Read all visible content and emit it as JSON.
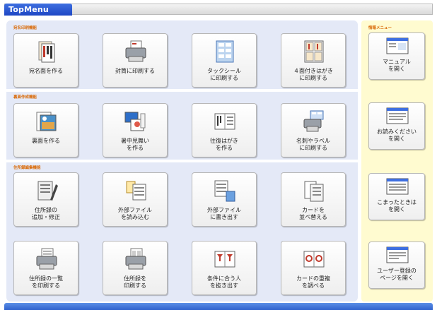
{
  "window": {
    "title": "TopMenu"
  },
  "sections": {
    "address_print": "宛名印刷機能",
    "front_create": "裏面作成機能",
    "address_book": "住所録編集機能",
    "info_menu": "情報メニュー"
  },
  "buttons": {
    "address_side": "宛名面を作る",
    "envelope": "封筒に印刷する",
    "tack_seal": "タックシール\nに印刷する",
    "four_side": "４面付きはがき\nに印刷する",
    "back_side": "裏面を作る",
    "summer_greeting": "暑中見舞い\nを作る",
    "return_postcard": "往復はがき\nを作る",
    "card_label": "名刺やラベル\nに印刷する",
    "add_edit": "住所録の\n追加・修正",
    "import_file": "外部ファイル\nを読み込む",
    "export_file": "外部ファイル\nに書き出す",
    "sort_cards": "カードを\n並べ替える",
    "print_list": "住所録の一覧\nを印刷する",
    "print_book": "住所録を\n印刷する",
    "extract": "条件に合う人\nを抜き出す",
    "duplicate": "カードの重複\nを調べる",
    "manual": "マニュアル\nを開く",
    "readme": "お読みください\nを開く",
    "trouble": "こまったときは\nを開く",
    "register": "ユーザー登録の\nページを開く"
  },
  "icons": {
    "address_side": "postcard-stack-icon",
    "envelope": "printer-envelope-icon",
    "tack_seal": "label-sheet-icon",
    "four_side": "four-postcards-icon",
    "back_side": "picture-postcard-icon",
    "summer_greeting": "summer-postcard-icon",
    "return_postcard": "return-postcard-icon",
    "card_label": "printer-cards-icon",
    "add_edit": "address-book-edit-icon",
    "import_file": "file-import-icon",
    "export_file": "file-export-icon",
    "sort_cards": "card-sort-icon",
    "print_list": "printer-list-icon",
    "print_book": "printer-book-icon",
    "extract": "card-filter-icon",
    "duplicate": "card-duplicate-icon",
    "manual": "document-window-icon",
    "readme": "readme-window-icon",
    "trouble": "help-window-icon",
    "register": "register-window-icon"
  },
  "colors": {
    "title_tab": "#1d46c4",
    "section_label": "#d96a08",
    "left_panel": "#e4e9f7",
    "right_panel": "#fffbd0"
  }
}
